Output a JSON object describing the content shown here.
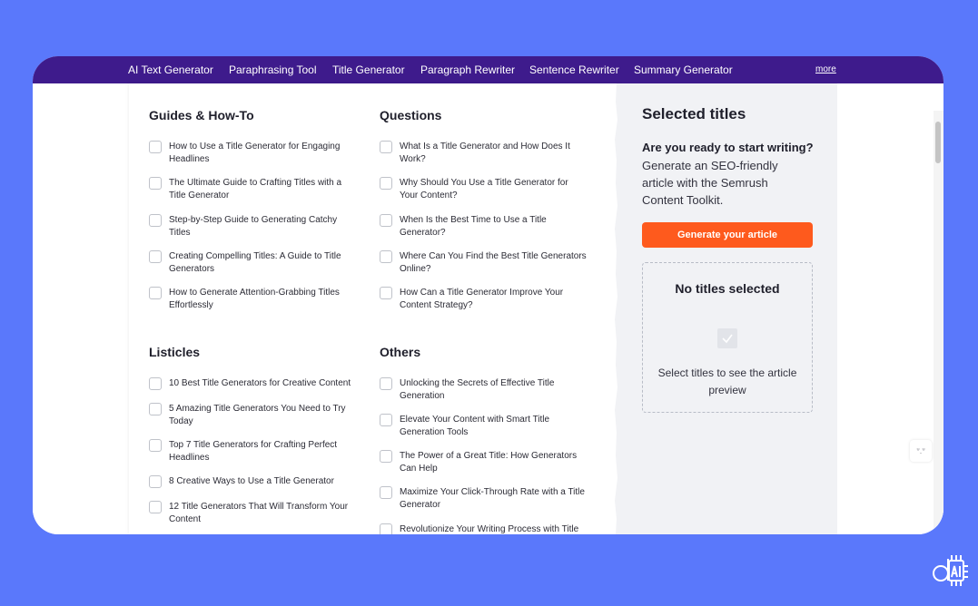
{
  "topnav": {
    "links": [
      "AI Text Generator",
      "Paraphrasing Tool",
      "Title Generator",
      "Paragraph Rewriter",
      "Sentence Rewriter",
      "Summary Generator"
    ],
    "more": "more"
  },
  "sections": {
    "guides": {
      "title": "Guides & How-To",
      "items": [
        "How to Use a Title Generator for Engaging Headlines",
        "The Ultimate Guide to Crafting Titles with a Title Generator",
        "Step-by-Step Guide to Generating Catchy Titles",
        "Creating Compelling Titles: A Guide to Title Generators",
        "How to Generate Attention-Grabbing Titles Effortlessly"
      ]
    },
    "questions": {
      "title": "Questions",
      "items": [
        "What Is a Title Generator and How Does It Work?",
        "Why Should You Use a Title Generator for Your Content?",
        "When Is the Best Time to Use a Title Generator?",
        "Where Can You Find the Best Title Generators Online?",
        "How Can a Title Generator Improve Your Content Strategy?"
      ]
    },
    "listicles": {
      "title": "Listicles",
      "items": [
        "10 Best Title Generators for Creative Content",
        "5 Amazing Title Generators You Need to Try Today",
        "Top 7 Title Generators for Crafting Perfect Headlines",
        "8 Creative Ways to Use a Title Generator",
        "12 Title Generators That Will Transform Your Content"
      ]
    },
    "others": {
      "title": "Others",
      "items": [
        "Unlocking the Secrets of Effective Title Generation",
        "Elevate Your Content with Smart Title Generation Tools",
        "The Power of a Great Title: How Generators Can Help",
        "Maximize Your Click-Through Rate with a Title Generator",
        "Revolutionize Your Writing Process with Title"
      ]
    }
  },
  "selected": {
    "title": "Selected titles",
    "question": "Are you ready to start writing?",
    "description": "Generate an SEO-friendly article with the Semrush Content Toolkit.",
    "button": "Generate your article",
    "empty_title": "No titles selected",
    "empty_text": "Select titles to see the article preview"
  },
  "colors": {
    "background": "#5a78fb",
    "nav": "#3e1b8c",
    "accent": "#fe5a1d",
    "panel": "#f1f2f5"
  },
  "icons": {
    "checkbox": "checkbox-icon",
    "preview_check": "check-square-icon",
    "side_widget": "emoji-face-icon",
    "corner_logo": "ai-chip-logo-icon"
  },
  "side_widget": {
    "glyph": "ᐡ.ᐡ"
  }
}
